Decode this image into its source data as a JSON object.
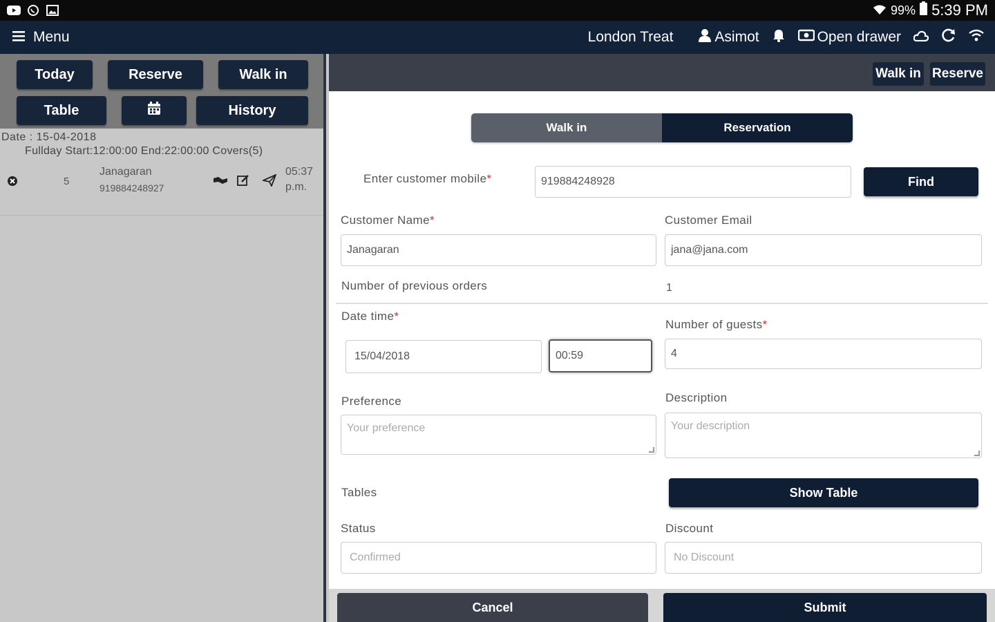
{
  "status_bar": {
    "battery_pct": "99%",
    "time": "5:39 PM",
    "icons": [
      "youtube-icon",
      "whatsapp-icon",
      "gallery-icon",
      "wifi-icon",
      "battery-icon"
    ]
  },
  "topbar": {
    "menu_label": "Menu",
    "restaurant": "London Treat",
    "user": "Asimot",
    "drawer_label": "Open drawer"
  },
  "left_toolbar": {
    "today": "Today",
    "reserve": "Reserve",
    "walkin": "Walk in",
    "table": "Table",
    "history": "History"
  },
  "summary": {
    "date_line": "Date : 15-04-2018",
    "fullday_line": "Fullday Start:12:00:00 End:22:00:00 Covers(5)"
  },
  "reservations": [
    {
      "guests": "5",
      "name": "Janagaran",
      "phone": "919884248927",
      "time": "05:37",
      "ampm": "p.m."
    }
  ],
  "right_toolbar": {
    "walkin": "Walk in",
    "reserve": "Reserve"
  },
  "form": {
    "tabs": {
      "walkin": "Walk in",
      "reservation": "Reservation",
      "active": "reservation"
    },
    "mobile_label": "Enter customer mobile",
    "mobile_value": "919884248928",
    "find_label": "Find",
    "name_label": "Customer Name",
    "name_value": "Janagaran",
    "email_label": "Customer Email",
    "email_value": "jana@jana.com",
    "prev_orders_label": "Number of previous orders",
    "prev_orders_value": "1",
    "datetime_label": "Date time",
    "date_value": "15/04/2018",
    "time_value": "00:59",
    "guests_label": "Number of guests",
    "guests_value": "4",
    "preference_label": "Preference",
    "preference_placeholder": "Your preference",
    "description_label": "Description",
    "description_placeholder": "Your description",
    "tables_label": "Tables",
    "show_table_label": "Show Table",
    "status_label": "Status",
    "status_value": "Confirmed",
    "discount_label": "Discount",
    "discount_value": "No Discount",
    "required_mark": "*",
    "cancel_label": "Cancel",
    "submit_label": "Submit"
  }
}
